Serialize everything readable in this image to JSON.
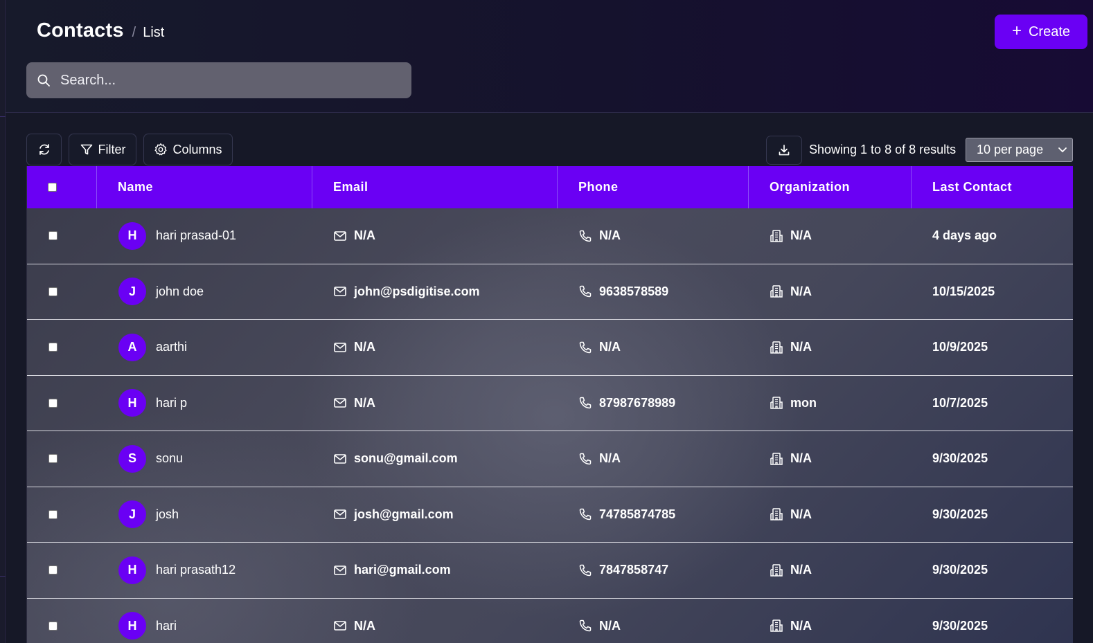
{
  "header": {
    "title": "Contacts",
    "separator": "/",
    "crumb": "List",
    "create_label": "Create",
    "create_icon": "plus-icon"
  },
  "search": {
    "placeholder": "Search..."
  },
  "toolbar": {
    "filter_label": "Filter",
    "columns_label": "Columns",
    "results_text": "Showing 1 to 8 of 8 results",
    "per_page": "10 per page"
  },
  "table": {
    "columns": [
      "Name",
      "Email",
      "Phone",
      "Organization",
      "Last Contact"
    ],
    "rows": [
      {
        "initial": "H",
        "name": "hari prasad-01",
        "email": "N/A",
        "phone": "N/A",
        "org": "N/A",
        "last": "4 days ago"
      },
      {
        "initial": "J",
        "name": "john doe",
        "email": "john@psdigitise.com",
        "phone": "9638578589",
        "org": "N/A",
        "last": "10/15/2025"
      },
      {
        "initial": "A",
        "name": "aarthi",
        "email": "N/A",
        "phone": "N/A",
        "org": "N/A",
        "last": "10/9/2025"
      },
      {
        "initial": "H",
        "name": "hari p",
        "email": "N/A",
        "phone": "87987678989",
        "org": "mon",
        "last": "10/7/2025"
      },
      {
        "initial": "S",
        "name": "sonu",
        "email": "sonu@gmail.com",
        "phone": "N/A",
        "org": "N/A",
        "last": "9/30/2025"
      },
      {
        "initial": "J",
        "name": "josh",
        "email": "josh@gmail.com",
        "phone": "74785874785",
        "org": "N/A",
        "last": "9/30/2025"
      },
      {
        "initial": "H",
        "name": "hari prasath12",
        "email": "hari@gmail.com",
        "phone": "7847858747",
        "org": "N/A",
        "last": "9/30/2025"
      },
      {
        "initial": "H",
        "name": "hari",
        "email": "N/A",
        "phone": "N/A",
        "org": "N/A",
        "last": "9/30/2025"
      }
    ]
  },
  "colors": {
    "accent": "#6a00f4",
    "background": "#161827",
    "search_bg": "#62616f"
  }
}
